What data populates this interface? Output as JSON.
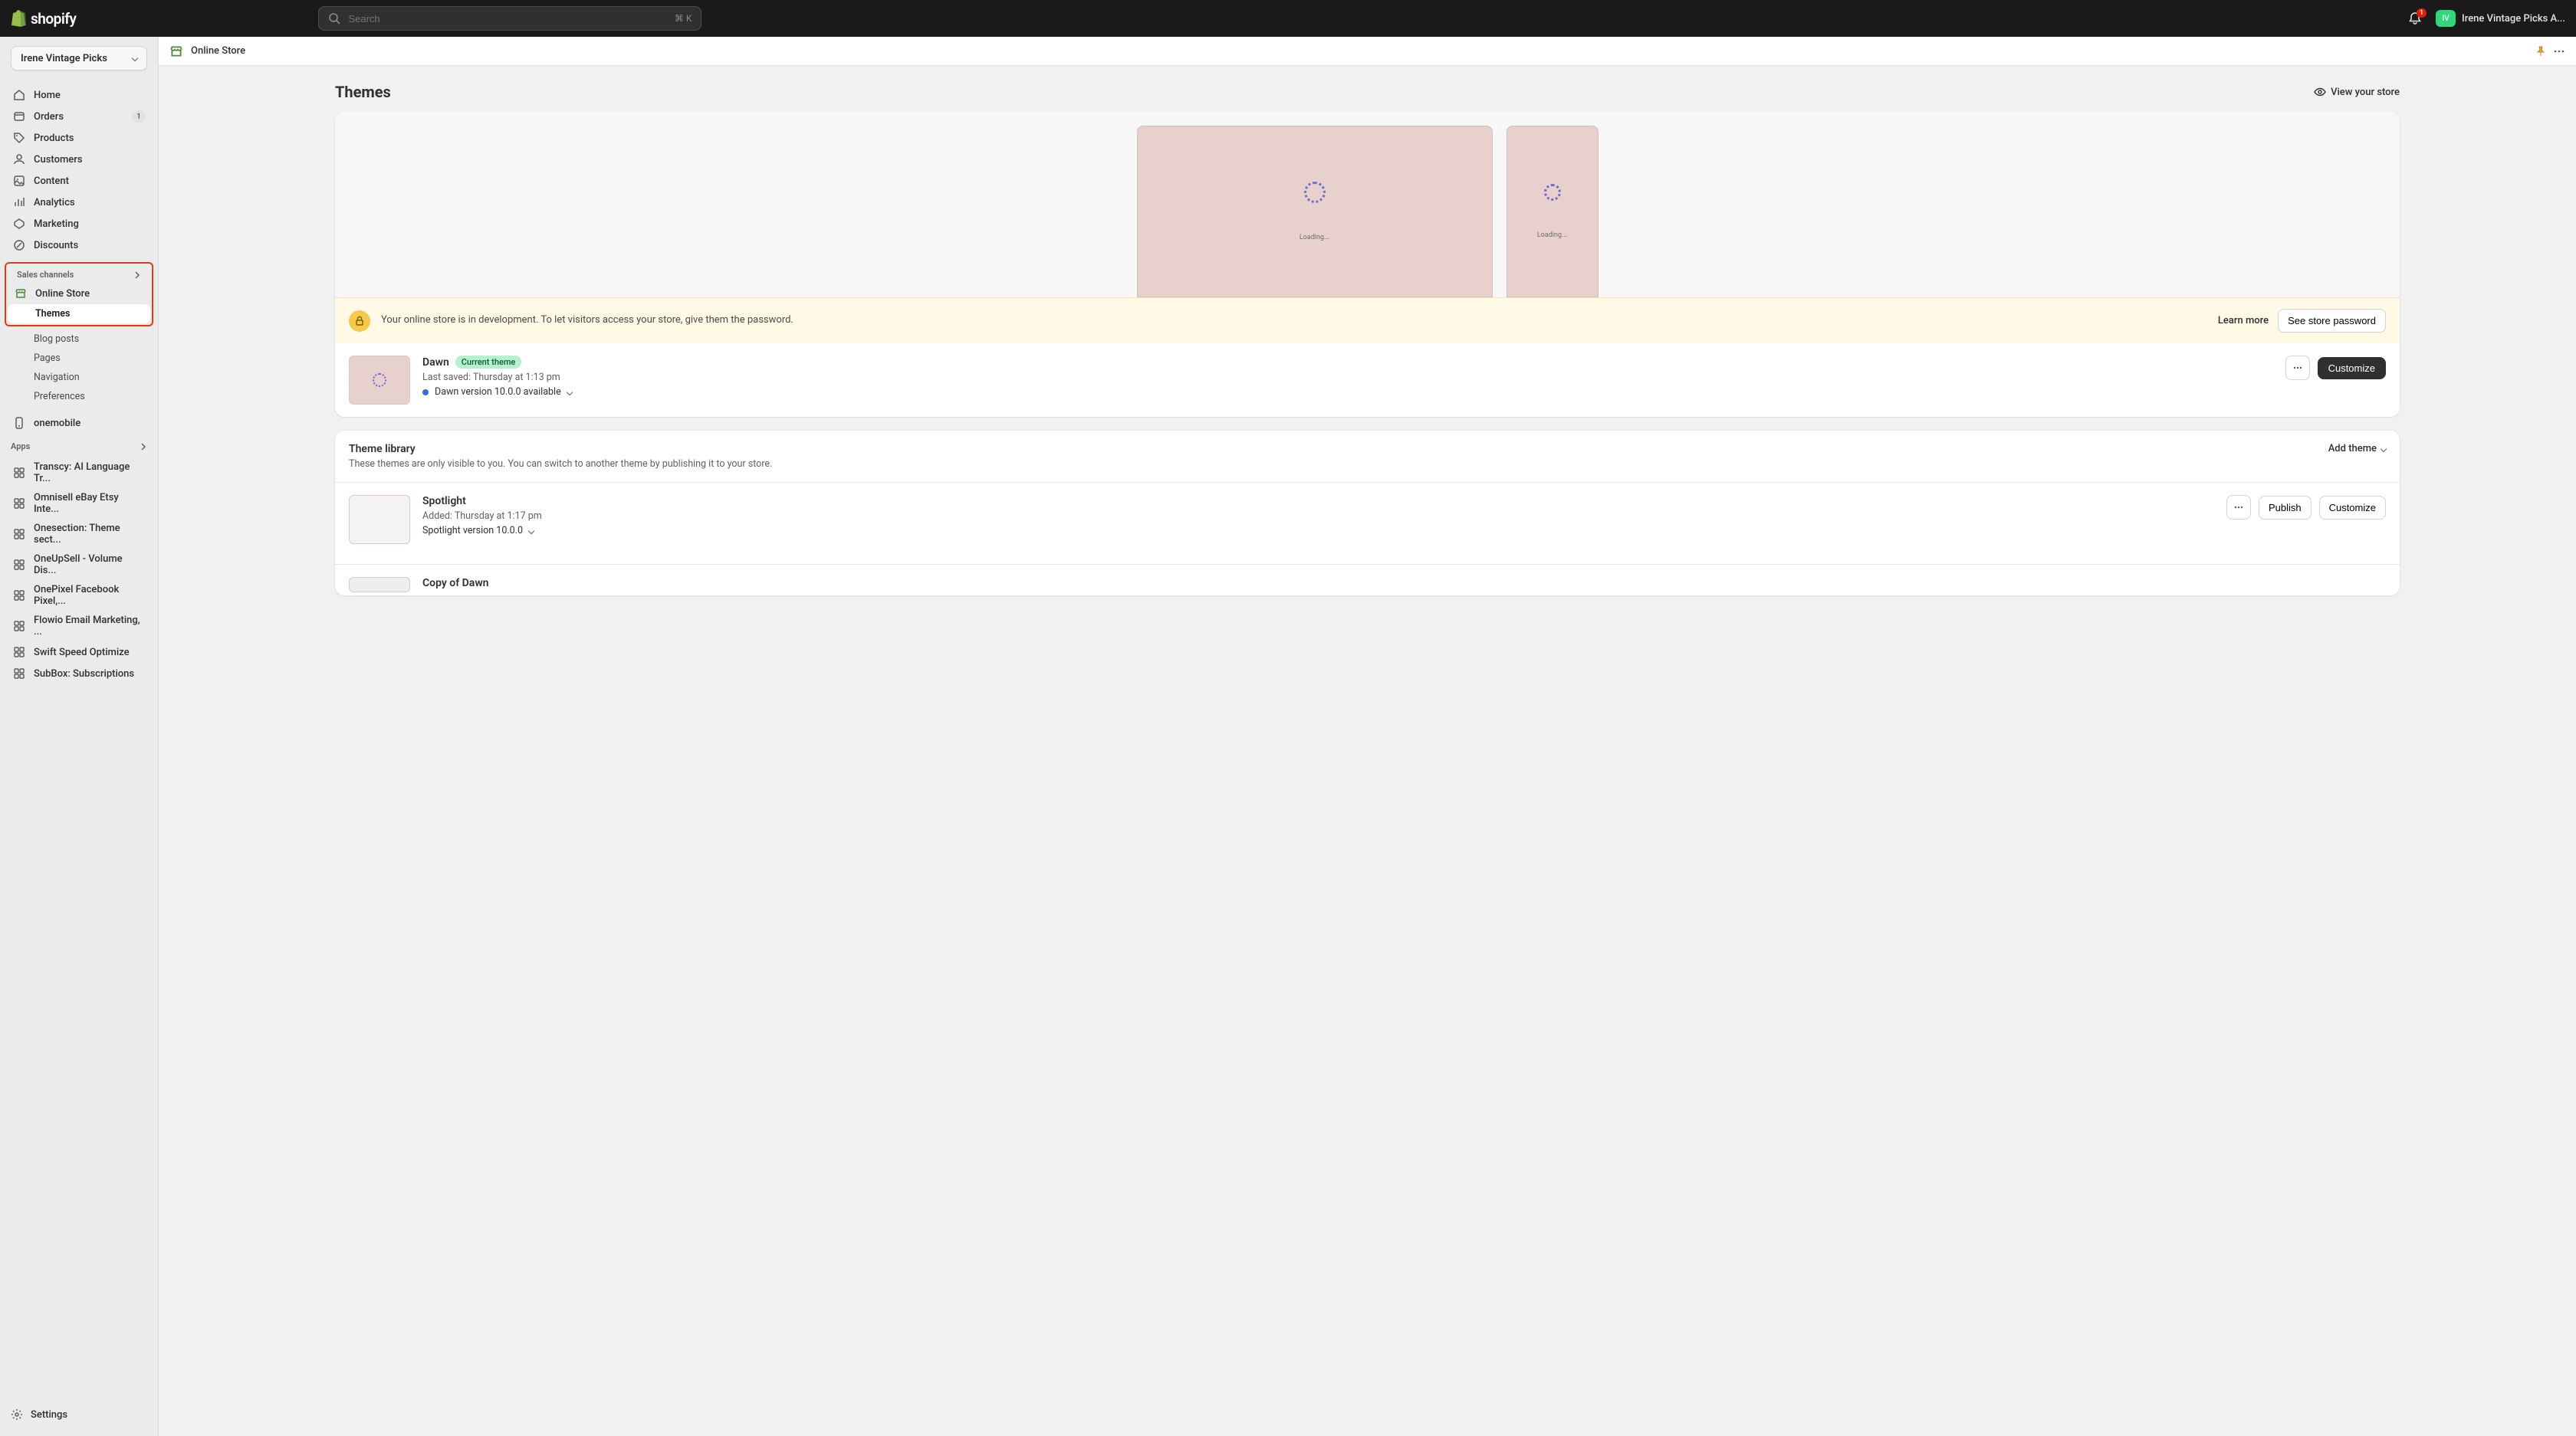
{
  "topbar": {
    "brand": "shopify",
    "search_placeholder": "Search",
    "search_shortcut": "⌘ K",
    "notification_count": "1",
    "store_name": "Irene Vintage Picks A..."
  },
  "store_selector": "Irene Vintage Picks",
  "nav": {
    "home": "Home",
    "orders": "Orders",
    "orders_badge": "1",
    "products": "Products",
    "customers": "Customers",
    "content": "Content",
    "analytics": "Analytics",
    "marketing": "Marketing",
    "discounts": "Discounts"
  },
  "sales_channels_label": "Sales channels",
  "online_store": {
    "label": "Online Store",
    "themes": "Themes",
    "blog_posts": "Blog posts",
    "pages": "Pages",
    "navigation": "Navigation",
    "preferences": "Preferences"
  },
  "onemobile": "onemobile",
  "apps_label": "Apps",
  "apps": [
    "Transcy: AI Language Tr...",
    "Omnisell eBay Etsy Inte...",
    "Onesection: Theme sect...",
    "OneUpSell - Volume Dis...",
    "OnePixel Facebook Pixel,...",
    "Flowio Email Marketing, ...",
    "Swift Speed Optimize",
    "SubBox: Subscriptions"
  ],
  "settings": "Settings",
  "crumb": "Online Store",
  "page": {
    "title": "Themes",
    "view_store": "View your store"
  },
  "preview": {
    "loading": "Loading..."
  },
  "dev_banner": {
    "text": "Your online store is in development. To let visitors access your store, give them the password.",
    "learn_more": "Learn more",
    "see_password": "See store password"
  },
  "current_theme": {
    "name": "Dawn",
    "badge": "Current theme",
    "last_saved": "Last saved: Thursday at 1:13 pm",
    "version_note": "Dawn version 10.0.0 available",
    "customize": "Customize"
  },
  "library": {
    "title": "Theme library",
    "desc": "These themes are only visible to you. You can switch to another theme by publishing it to your store.",
    "add_theme": "Add theme",
    "items": [
      {
        "name": "Spotlight",
        "added": "Added: Thursday at 1:17 pm",
        "version": "Spotlight version 10.0.0",
        "publish": "Publish",
        "customize": "Customize"
      },
      {
        "name": "Copy of Dawn"
      }
    ]
  }
}
